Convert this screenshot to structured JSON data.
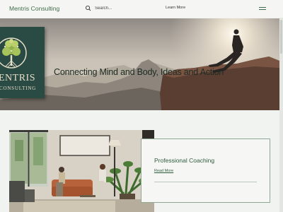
{
  "header": {
    "brand": "Mentris Consulting",
    "search_placeholder": "Search...",
    "learn_more": "Learn More"
  },
  "hero": {
    "title": "Connecting Mind and Body, Ideas and Action"
  },
  "logo": {
    "word": "ENTRIS",
    "sub": "CONSULTING"
  },
  "service": {
    "title": "Professional Coaching",
    "link": "Read More"
  },
  "colors": {
    "brand_green": "#2e5a3c",
    "logo_bg": "#2a4a44",
    "background": "#f1f3f0"
  }
}
